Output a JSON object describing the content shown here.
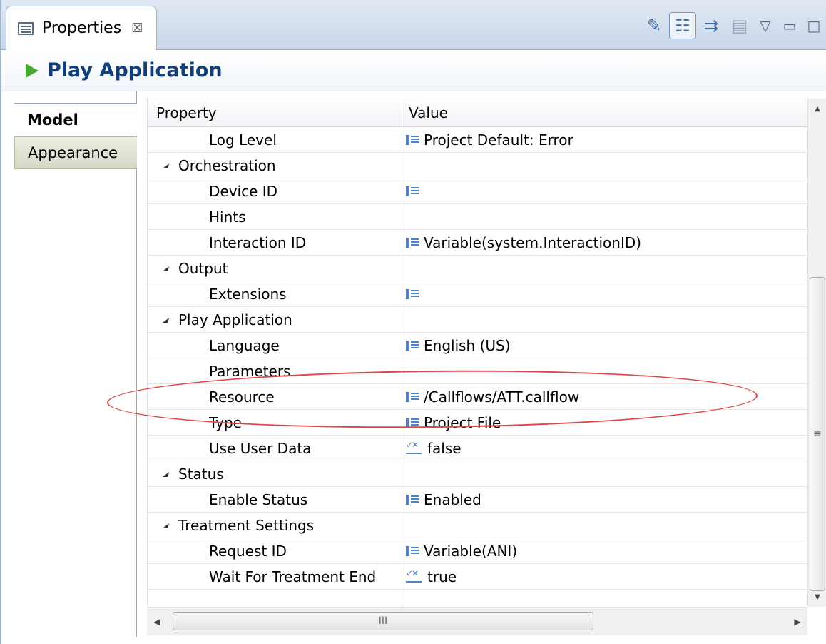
{
  "view": {
    "tab_label": "Properties",
    "tab_close": "☒",
    "title": "Play Application"
  },
  "toolbar": {
    "icons": [
      "pin-icon",
      "tree-icon",
      "filter-icon",
      "restore-icon",
      "view-menu-icon",
      "minimize-icon",
      "maximize-icon"
    ]
  },
  "left_tabs": [
    {
      "label": "Model",
      "active": true
    },
    {
      "label": "Appearance",
      "active": false
    }
  ],
  "grid": {
    "headers": {
      "property": "Property",
      "value": "Value"
    },
    "rows": [
      {
        "indent": 1,
        "group": false,
        "property": "Log Level",
        "icon": "list",
        "value": "Project Default: Error"
      },
      {
        "indent": 0,
        "group": true,
        "property": "Orchestration",
        "icon": "",
        "value": ""
      },
      {
        "indent": 1,
        "group": false,
        "property": "Device ID",
        "icon": "list",
        "value": ""
      },
      {
        "indent": 1,
        "group": false,
        "property": "Hints",
        "icon": "",
        "value": ""
      },
      {
        "indent": 1,
        "group": false,
        "property": "Interaction ID",
        "icon": "list",
        "value": "Variable(system.InteractionID)"
      },
      {
        "indent": 0,
        "group": true,
        "property": "Output",
        "icon": "",
        "value": ""
      },
      {
        "indent": 1,
        "group": false,
        "property": "Extensions",
        "icon": "list",
        "value": ""
      },
      {
        "indent": 0,
        "group": true,
        "property": "Play Application",
        "icon": "",
        "value": ""
      },
      {
        "indent": 1,
        "group": false,
        "property": "Language",
        "icon": "list",
        "value": "English (US)"
      },
      {
        "indent": 1,
        "group": false,
        "property": "Parameters",
        "icon": "",
        "value": ""
      },
      {
        "indent": 1,
        "group": false,
        "property": "Resource",
        "icon": "list",
        "value": "/Callflows/ATT.callflow"
      },
      {
        "indent": 1,
        "group": false,
        "property": "Type",
        "icon": "list",
        "value": "Project File"
      },
      {
        "indent": 1,
        "group": false,
        "property": "Use User Data",
        "icon": "bool",
        "value": "false"
      },
      {
        "indent": 0,
        "group": true,
        "property": "Status",
        "icon": "",
        "value": ""
      },
      {
        "indent": 1,
        "group": false,
        "property": "Enable Status",
        "icon": "list",
        "value": "Enabled"
      },
      {
        "indent": 0,
        "group": true,
        "property": "Treatment Settings",
        "icon": "",
        "value": ""
      },
      {
        "indent": 1,
        "group": false,
        "property": "Request ID",
        "icon": "list",
        "value": "Variable(ANI)"
      },
      {
        "indent": 1,
        "group": false,
        "property": "Wait For Treatment End",
        "icon": "bool",
        "value": "true"
      }
    ]
  },
  "scrollbar": {
    "h_thumb_grip": "III",
    "v_thumb_grip": "≡"
  },
  "colors": {
    "title": "#123f78",
    "play": "#44a832",
    "highlight": "#e04545",
    "icon": "#4f84c9"
  }
}
